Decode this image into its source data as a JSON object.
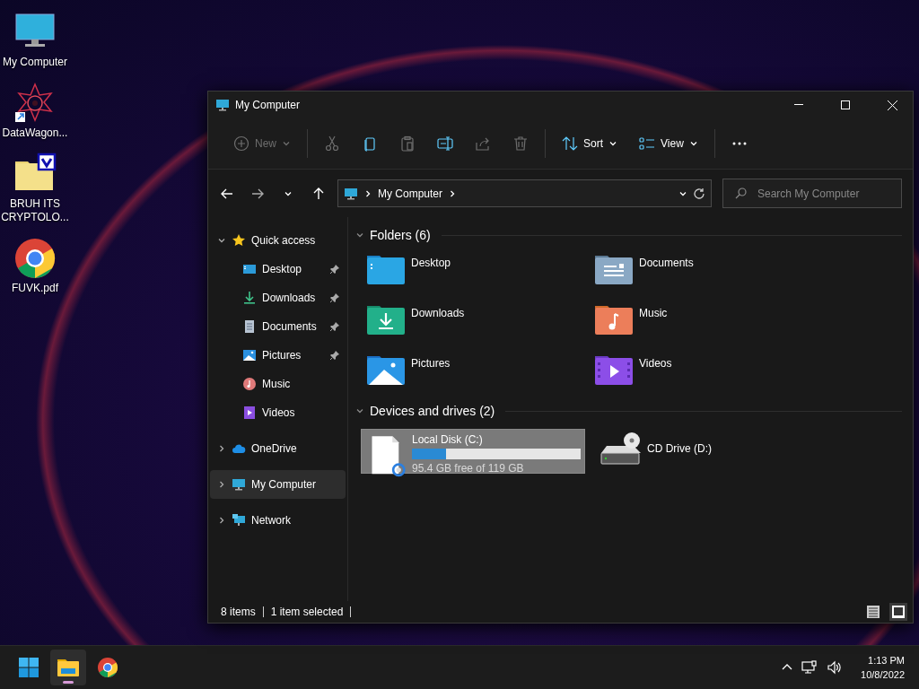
{
  "desktop_icons": [
    {
      "kind": "computer",
      "label": "My Computer"
    },
    {
      "kind": "shortcut",
      "label": "DataWagon..."
    },
    {
      "kind": "folder",
      "label": "BRUH ITS CRYPTOLO..."
    },
    {
      "kind": "chrome",
      "label": "FUVK.pdf"
    }
  ],
  "window": {
    "title": "My Computer"
  },
  "toolbar_groups": [
    {
      "items": [
        {
          "kind": "new",
          "label": "New",
          "disabled": true
        }
      ]
    },
    {
      "items": [
        {
          "kind": "cut",
          "disabled": true
        },
        {
          "kind": "copy",
          "disabled": false
        },
        {
          "kind": "paste",
          "disabled": true
        },
        {
          "kind": "rename",
          "disabled": false
        },
        {
          "kind": "share",
          "disabled": true
        },
        {
          "kind": "delete",
          "disabled": true
        }
      ]
    },
    {
      "items": [
        {
          "kind": "sort",
          "label": "Sort",
          "disabled": false
        },
        {
          "kind": "view",
          "label": "View",
          "disabled": false
        }
      ]
    },
    {
      "items": [
        {
          "kind": "more",
          "disabled": false
        }
      ]
    }
  ],
  "address": {
    "path": "My Computer",
    "search_placeholder": "Search My Computer"
  },
  "sidebar": [
    {
      "kind": "star",
      "label": "Quick access",
      "expanded": true,
      "selected": false,
      "children": [
        {
          "kind": "desktop",
          "label": "Desktop",
          "pinned": true,
          "selected": false
        },
        {
          "kind": "downloads",
          "label": "Downloads",
          "pinned": true,
          "selected": false
        },
        {
          "kind": "documents",
          "label": "Documents",
          "pinned": true,
          "selected": false
        },
        {
          "kind": "pictures",
          "label": "Pictures",
          "pinned": true,
          "selected": false
        },
        {
          "kind": "music",
          "label": "Music",
          "pinned": false,
          "selected": false
        },
        {
          "kind": "videos",
          "label": "Videos",
          "pinned": false,
          "selected": false
        }
      ]
    },
    {
      "kind": "cloud",
      "label": "OneDrive",
      "expanded": false,
      "selected": false
    },
    {
      "kind": "computer",
      "label": "My Computer",
      "expanded": false,
      "selected": true
    },
    {
      "kind": "network",
      "label": "Network",
      "expanded": false,
      "selected": false
    }
  ],
  "sections": [
    {
      "title": "Folders (6)",
      "expanded": true,
      "items": [
        {
          "kind": "desktop",
          "label": "Desktop",
          "selected": false
        },
        {
          "kind": "documents",
          "label": "Documents",
          "selected": false
        },
        {
          "kind": "downloads",
          "label": "Downloads",
          "selected": false
        },
        {
          "kind": "music",
          "label": "Music",
          "selected": false
        },
        {
          "kind": "pictures",
          "label": "Pictures",
          "selected": false
        },
        {
          "kind": "videos",
          "label": "Videos",
          "selected": false
        }
      ]
    },
    {
      "title": "Devices and drives (2)",
      "expanded": true,
      "items": [
        {
          "kind": "disk",
          "label": "Local Disk (C:)",
          "level": 0.2,
          "free": "95.4 GB free of 119 GB",
          "selected": true
        },
        {
          "kind": "cd",
          "label": "CD Drive (D:)",
          "selected": false
        }
      ]
    }
  ],
  "status": {
    "count": "8 items",
    "selection": "1 item selected"
  },
  "view_buttons": [
    {
      "kind": "details",
      "selected": false
    },
    {
      "kind": "tiles",
      "selected": true
    }
  ],
  "taskbar": {
    "apps": [
      {
        "kind": "start",
        "active": false
      },
      {
        "kind": "explorer",
        "active": true
      },
      {
        "kind": "chrome",
        "active": false
      }
    ],
    "time": "1:13 PM",
    "date": "10/8/2022"
  }
}
